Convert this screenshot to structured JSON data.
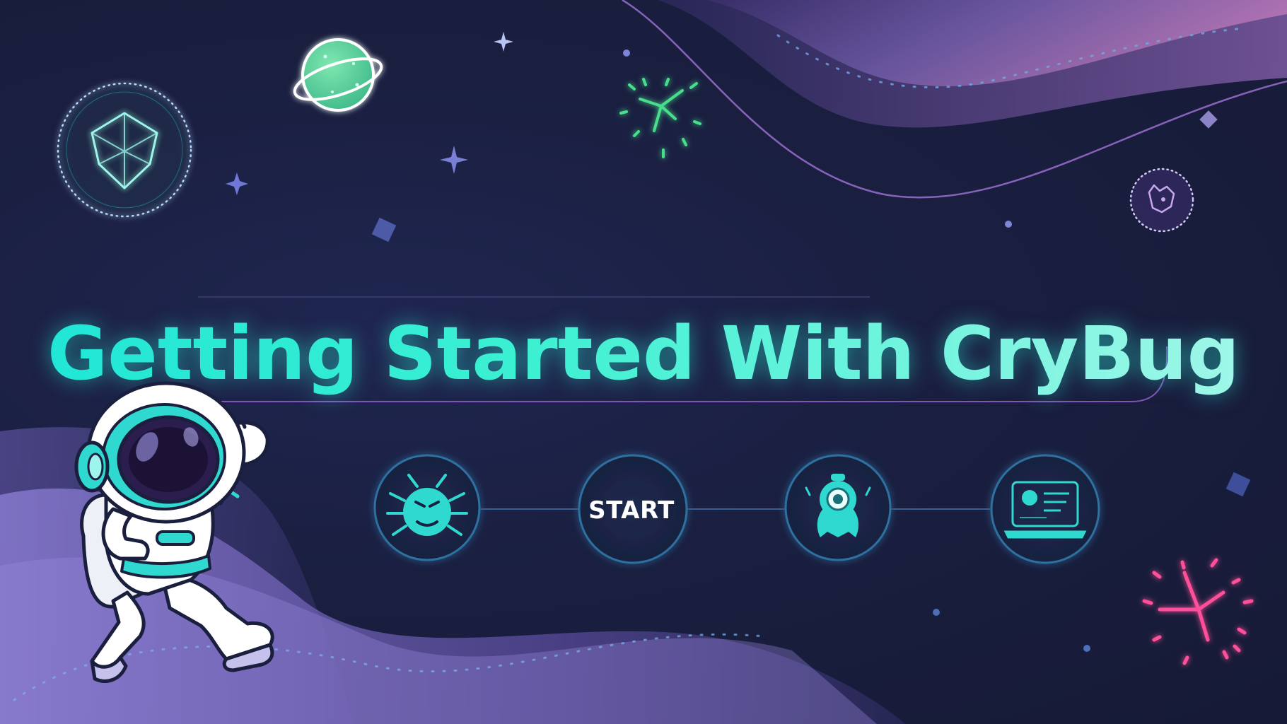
{
  "title": "Getting Started With CryBug",
  "steps": [
    {
      "icon": "bug-icon"
    },
    {
      "label": "START"
    },
    {
      "icon": "robot-icon"
    },
    {
      "icon": "laptop-icon"
    }
  ],
  "colors": {
    "background": "#1a1f3e",
    "title_start": "#21e6d6",
    "title_end": "#9ff7e8",
    "accent_teal": "#2fd9cf",
    "accent_green": "#4be08f",
    "accent_pink": "#ff4f9a",
    "wave_purple": "#8c6bc8"
  }
}
